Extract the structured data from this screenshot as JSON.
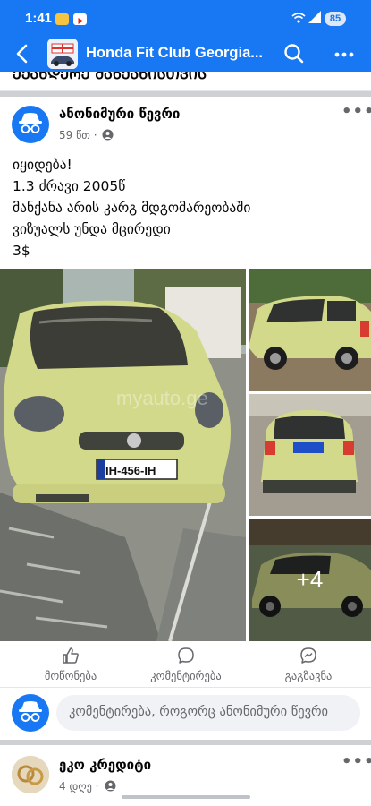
{
  "status_bar": {
    "time": "1:41",
    "battery": "85"
  },
  "header": {
    "title": "Honda Fit Club Georgia..."
  },
  "cutoff_text": "ᲔᲥᲐᲜᲓᲔᲠᲔ ᲛᲐᲜᲥᲐᲜᲘᲡᲗᲕᲘᲡ",
  "post": {
    "author": "ანონიმური წევრი",
    "time": "59 წთ ·",
    "lines": [
      "იყიდება!",
      "1.3 ძრავი 2005წ",
      "მანქანა არის კარგ მდგომარეობაში",
      "ვიზუალს უნდა მცირედი",
      "3$"
    ],
    "photos": {
      "more_count": "+4",
      "plate": "IH-456-IH",
      "watermark": "myauto.ge"
    },
    "actions": {
      "like": "მოწონება",
      "comment": "კომენტირება",
      "share": "გაგზავნა"
    },
    "comment_placeholder": "კომენტირება, როგორც ანონიმური წევრი"
  },
  "next_post": {
    "author": "ეკო კრედიტი",
    "time": "4 დღე ·"
  },
  "colors": {
    "brand_blue": "#1877f2",
    "car_yellow": "#d3d98a",
    "meta_gray": "#65676b"
  },
  "icons": [
    "back-arrow-icon",
    "search-icon",
    "more-icon",
    "anonymous-icon",
    "globe-icon",
    "like-icon",
    "comment-icon",
    "share-icon"
  ]
}
